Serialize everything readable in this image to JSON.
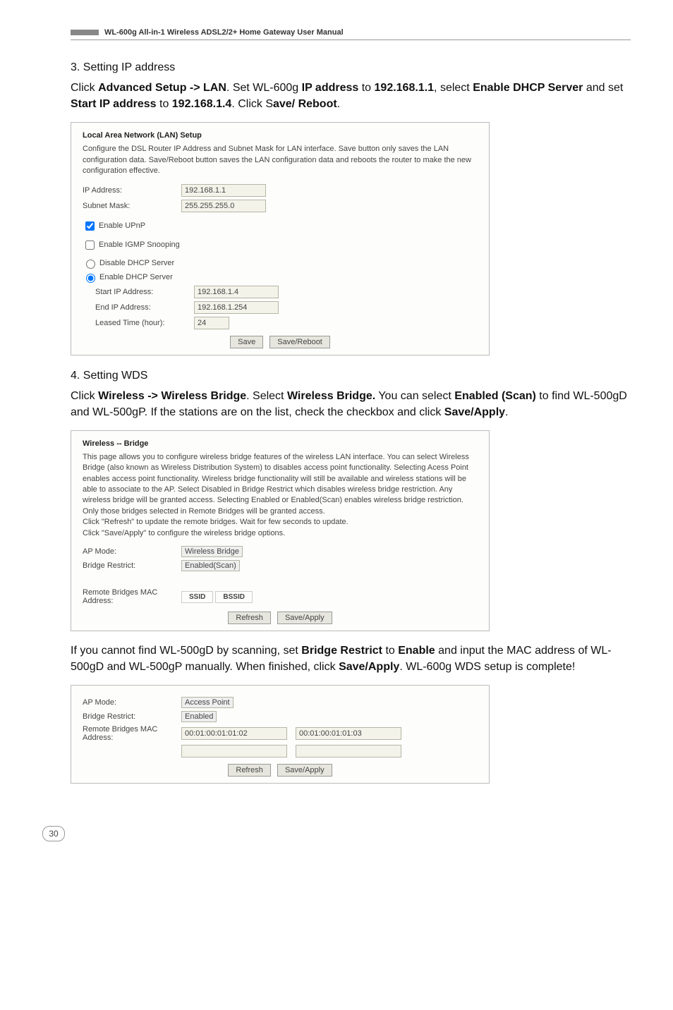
{
  "header": "WL-600g All-in-1 Wireless ADSL2/2+ Home Gateway User Manual",
  "s3": {
    "step": "3.   Setting IP address",
    "instr_pre": "Click ",
    "b1": "Advanced Setup -> LAN",
    "mid1": ". Set WL-600g ",
    "b2": "IP address",
    "mid2": " to ",
    "b3": "192.168.1.1",
    "mid3": ", select ",
    "b4": "Enable DHCP Server",
    "mid4": " and set ",
    "b5": "Start IP address",
    "mid5": " to ",
    "b6": "192.168.1.4",
    "mid6": ". Click S",
    "b7": "ave/ Reboot",
    "end": "."
  },
  "lan": {
    "title": "Local Area Network (LAN) Setup",
    "note": "Configure the DSL Router IP Address and Subnet Mask for LAN interface. Save button only saves the LAN configuration data. Save/Reboot button saves the LAN configuration data and reboots the router to make the new configuration effective.",
    "ip_lbl": "IP Address:",
    "ip_val": "192.168.1.1",
    "mask_lbl": "Subnet Mask:",
    "mask_val": "255.255.255.0",
    "upnp": "Enable UPnP",
    "igmp": "Enable IGMP Snooping",
    "dhcp_dis": "Disable DHCP Server",
    "dhcp_en": "Enable DHCP Server",
    "start_lbl": "Start IP Address:",
    "start_val": "192.168.1.4",
    "end_lbl": "End IP Address:",
    "end_val": "192.168.1.254",
    "lease_lbl": "Leased Time (hour):",
    "lease_val": "24",
    "btn_save": "Save",
    "btn_reboot": "Save/Reboot"
  },
  "s4": {
    "step": "4.   Setting WDS",
    "pre": "Click ",
    "b1": "Wireless -> Wireless Bridge",
    "mid1": ". Select ",
    "b2": "Wireless Bridge.",
    "mid2": " You can select ",
    "b3": "Enabled (Scan)",
    "mid3": " to find WL-500gD and WL-500gP. If the stations are on the list, check the checkbox and click ",
    "b4": "Save/Apply",
    "end": "."
  },
  "bridge": {
    "title": "Wireless -- Bridge",
    "note": "This page allows you to configure wireless bridge features of the wireless LAN interface. You can select Wireless Bridge (also known as Wireless Distribution System) to disables access point functionality. Selecting Acess Point enables access point functionality. Wireless bridge functionality will still be available and wireless stations will be able to associate to the AP. Select Disabled in Bridge Restrict which disables wireless bridge restriction. Any wireless bridge will be granted access. Selecting Enabled or Enabled(Scan) enables wireless bridge restriction. Only those bridges selected in Remote Bridges will be granted access.\nClick \"Refresh\" to update the remote bridges. Wait for few seconds to update.\nClick \"Save/Apply\" to configure the wireless bridge options.",
    "mode_lbl": "AP Mode:",
    "mode_val": "Wireless Bridge",
    "restrict_lbl": "Bridge Restrict:",
    "restrict_val": "Enabled(Scan)",
    "remote_lbl": "Remote Bridges MAC Address:",
    "col_ssid": "SSID",
    "col_bssid": "BSSID",
    "btn_refresh": "Refresh",
    "btn_apply": "Save/Apply"
  },
  "p_after": {
    "pre": "If you cannot find WL-500gD by scanning, set ",
    "b1": "Bridge Restrict",
    "mid1": " to ",
    "b2": "Enable",
    "mid2": " and input the MAC address of WL-500gD and WL-500gP manually. When finished, click ",
    "b3": "Save/Apply",
    "mid3": ". WL-600g WDS setup is complete!"
  },
  "bridge2": {
    "mode_lbl": "AP Mode:",
    "mode_val": "Access Point",
    "restrict_lbl": "Bridge Restrict:",
    "restrict_val": "Enabled",
    "remote_lbl": "Remote Bridges MAC Address:",
    "mac1": "00:01:00:01:01:02",
    "mac2": "00:01:00:01:01:03",
    "btn_refresh": "Refresh",
    "btn_apply": "Save/Apply"
  },
  "pagenum": "30"
}
